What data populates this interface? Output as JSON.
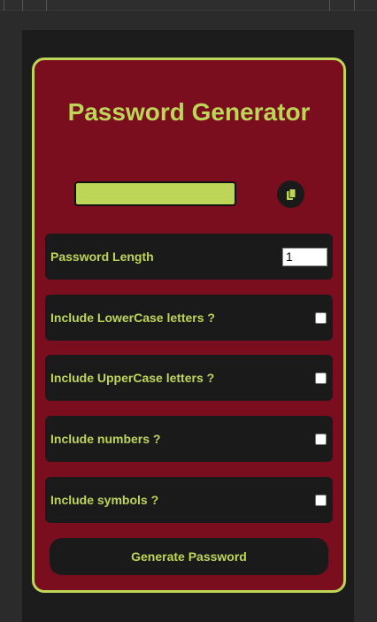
{
  "app": {
    "title": "Password Generator"
  },
  "result": {
    "value": ""
  },
  "copy": {
    "icon": "copy-icon"
  },
  "options": {
    "length": {
      "label": "Password Length",
      "value": "1"
    },
    "lowercase": {
      "label": "Include LowerCase letters ?",
      "checked": false
    },
    "uppercase": {
      "label": "Include UpperCase letters ?",
      "checked": false
    },
    "numbers": {
      "label": "Include numbers ?",
      "checked": false
    },
    "symbols": {
      "label": "Include symbols ?",
      "checked": false
    }
  },
  "actions": {
    "generate_label": "Generate Password"
  },
  "colors": {
    "accent": "#bdd657",
    "card_background": "#7a0d1e",
    "panel": "#1a1a1a"
  }
}
